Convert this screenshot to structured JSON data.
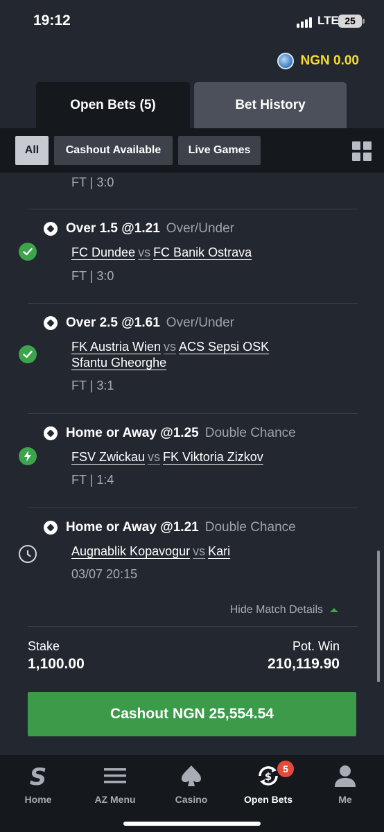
{
  "status_bar": {
    "time": "19:12",
    "network": "LTE",
    "battery": "25"
  },
  "header": {
    "balance": "NGN 0.00"
  },
  "tabs": [
    {
      "label": "Open Bets (5)",
      "active": true
    },
    {
      "label": "Bet History",
      "active": false
    }
  ],
  "filters": [
    {
      "label": "All",
      "active": true
    },
    {
      "label": "Cashout Available",
      "active": false
    },
    {
      "label": "Live Games",
      "active": false
    }
  ],
  "bet": {
    "top_result": "FT | 3:0",
    "legs": [
      {
        "status": "won",
        "pick": "Over 1.5 @1.21",
        "market": "Over/Under",
        "home": "FC Dundee",
        "vs": "vs",
        "away": "FC Banik Ostrava",
        "away_line2": "",
        "result": "FT | 3:0"
      },
      {
        "status": "won",
        "pick": "Over 2.5 @1.61",
        "market": "Over/Under",
        "home": "FK Austria Wien",
        "vs": "vs",
        "away": "ACS Sepsi OSK",
        "away_line2": "Sfantu Gheorghe",
        "result": "FT | 3:1"
      },
      {
        "status": "live",
        "pick": "Home or Away @1.25",
        "market": "Double Chance",
        "home": "FSV Zwickau",
        "vs": "vs",
        "away": "FK Viktoria Zizkov",
        "away_line2": "",
        "result": "FT | 1:4"
      },
      {
        "status": "pending",
        "pick": "Home or Away @1.21",
        "market": "Double Chance",
        "home": "Augnablik Kopavogur",
        "vs": "vs",
        "away": "Kari",
        "away_line2": "",
        "result": "03/07 20:15"
      }
    ],
    "hide_details_label": "Hide Match Details",
    "stake_label": "Stake",
    "stake": "1,100.00",
    "pot_win_label": "Pot. Win",
    "pot_win": "210,119.90",
    "cashout_label": "Cashout",
    "cashout_amount": "NGN 25,554.54"
  },
  "nav": [
    {
      "label": "Home",
      "icon": "sportybet-s-icon"
    },
    {
      "label": "AZ Menu",
      "icon": "hamburger-icon"
    },
    {
      "label": "Casino",
      "icon": "spade-icon"
    },
    {
      "label": "Open Bets",
      "icon": "open-bets-icon",
      "badge": "5",
      "active": true
    },
    {
      "label": "Me",
      "icon": "user-icon"
    }
  ],
  "colors": {
    "accent_green": "#3b9b49",
    "balance_yellow": "#f5dd2f",
    "badge_red": "#e5493a"
  }
}
